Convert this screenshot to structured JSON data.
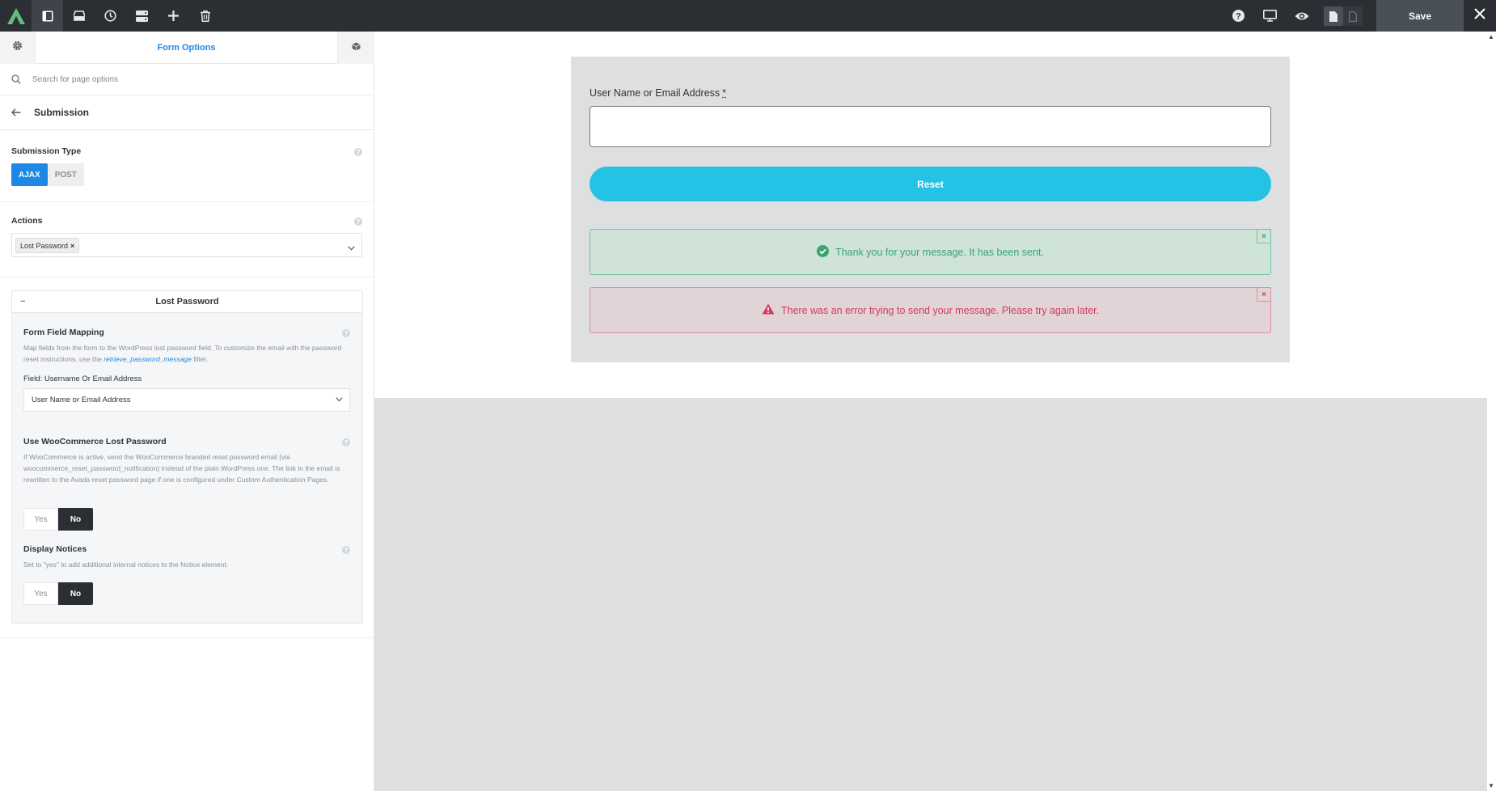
{
  "toolbar": {
    "save_label": "Save",
    "icons": [
      "avada-logo",
      "sidebar-toggle-icon",
      "library-icon",
      "history-icon",
      "layout-icon",
      "add-icon",
      "trash-icon",
      "help-icon",
      "desktop-icon",
      "preview-icon",
      "page-icon",
      "page-outline-icon",
      "close-icon"
    ]
  },
  "sidebar": {
    "tab_title": "Form Options",
    "search_placeholder": "Search for page options",
    "section_title": "Submission",
    "submission_type": {
      "label": "Submission Type",
      "options": [
        "AJAX",
        "POST"
      ],
      "selected": "AJAX"
    },
    "actions": {
      "label": "Actions",
      "tags": [
        "Lost Password"
      ],
      "tag_remove": "×"
    },
    "lost_password": {
      "title": "Lost Password",
      "collapse": "−",
      "field_mapping": {
        "label": "Form Field Mapping",
        "desc_before": "Map fields from the form to the WordPress lost password field. To customize the email with the password reset instructions, use the ",
        "desc_link": "retrieve_password_message",
        "desc_after": " filter.",
        "field_label": "Field: Username Or Email Address",
        "field_value": "User Name or Email Address"
      },
      "woocommerce": {
        "label": "Use WooCommerce Lost Password",
        "desc": "If WooCommerce is active, send the WooCommerce branded reset password email (via woocommerce_reset_password_notification) instead of the plain WordPress one. The link in the email is rewritten to the Avada reset password page if one is configured under Custom Authentication Pages.",
        "yes": "Yes",
        "no": "No",
        "selected": "No"
      },
      "display_notices": {
        "label": "Display Notices",
        "desc": "Set to \"yes\" to add additional internal notices to the Notice element.",
        "yes": "Yes",
        "no": "No",
        "selected": "No"
      }
    }
  },
  "canvas": {
    "field_label": "User Name or Email Address",
    "required_mark": "*",
    "input_value": "",
    "button_label": "Reset",
    "success_notice": "Thank you for your message. It has been sent.",
    "error_notice": "There was an error trying to send your message. Please try again later.",
    "notice_close": "×"
  },
  "colors": {
    "accent": "#1e88e5",
    "toolbar_bg": "#2b2f34",
    "button": "#24c3e6",
    "success": "#3aa470",
    "error": "#d13a5a"
  }
}
